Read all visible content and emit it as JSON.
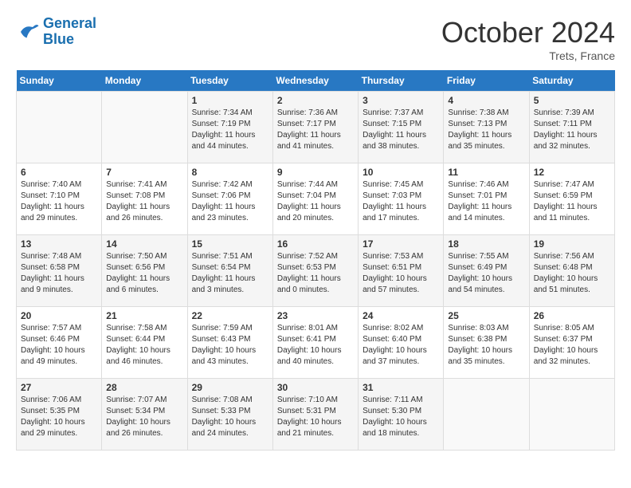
{
  "logo": {
    "line1": "General",
    "line2": "Blue"
  },
  "title": "October 2024",
  "subtitle": "Trets, France",
  "days_header": [
    "Sunday",
    "Monday",
    "Tuesday",
    "Wednesday",
    "Thursday",
    "Friday",
    "Saturday"
  ],
  "weeks": [
    [
      {
        "day": "",
        "sunrise": "",
        "sunset": "",
        "daylight": ""
      },
      {
        "day": "",
        "sunrise": "",
        "sunset": "",
        "daylight": ""
      },
      {
        "day": "1",
        "sunrise": "Sunrise: 7:34 AM",
        "sunset": "Sunset: 7:19 PM",
        "daylight": "Daylight: 11 hours and 44 minutes."
      },
      {
        "day": "2",
        "sunrise": "Sunrise: 7:36 AM",
        "sunset": "Sunset: 7:17 PM",
        "daylight": "Daylight: 11 hours and 41 minutes."
      },
      {
        "day": "3",
        "sunrise": "Sunrise: 7:37 AM",
        "sunset": "Sunset: 7:15 PM",
        "daylight": "Daylight: 11 hours and 38 minutes."
      },
      {
        "day": "4",
        "sunrise": "Sunrise: 7:38 AM",
        "sunset": "Sunset: 7:13 PM",
        "daylight": "Daylight: 11 hours and 35 minutes."
      },
      {
        "day": "5",
        "sunrise": "Sunrise: 7:39 AM",
        "sunset": "Sunset: 7:11 PM",
        "daylight": "Daylight: 11 hours and 32 minutes."
      }
    ],
    [
      {
        "day": "6",
        "sunrise": "Sunrise: 7:40 AM",
        "sunset": "Sunset: 7:10 PM",
        "daylight": "Daylight: 11 hours and 29 minutes."
      },
      {
        "day": "7",
        "sunrise": "Sunrise: 7:41 AM",
        "sunset": "Sunset: 7:08 PM",
        "daylight": "Daylight: 11 hours and 26 minutes."
      },
      {
        "day": "8",
        "sunrise": "Sunrise: 7:42 AM",
        "sunset": "Sunset: 7:06 PM",
        "daylight": "Daylight: 11 hours and 23 minutes."
      },
      {
        "day": "9",
        "sunrise": "Sunrise: 7:44 AM",
        "sunset": "Sunset: 7:04 PM",
        "daylight": "Daylight: 11 hours and 20 minutes."
      },
      {
        "day": "10",
        "sunrise": "Sunrise: 7:45 AM",
        "sunset": "Sunset: 7:03 PM",
        "daylight": "Daylight: 11 hours and 17 minutes."
      },
      {
        "day": "11",
        "sunrise": "Sunrise: 7:46 AM",
        "sunset": "Sunset: 7:01 PM",
        "daylight": "Daylight: 11 hours and 14 minutes."
      },
      {
        "day": "12",
        "sunrise": "Sunrise: 7:47 AM",
        "sunset": "Sunset: 6:59 PM",
        "daylight": "Daylight: 11 hours and 11 minutes."
      }
    ],
    [
      {
        "day": "13",
        "sunrise": "Sunrise: 7:48 AM",
        "sunset": "Sunset: 6:58 PM",
        "daylight": "Daylight: 11 hours and 9 minutes."
      },
      {
        "day": "14",
        "sunrise": "Sunrise: 7:50 AM",
        "sunset": "Sunset: 6:56 PM",
        "daylight": "Daylight: 11 hours and 6 minutes."
      },
      {
        "day": "15",
        "sunrise": "Sunrise: 7:51 AM",
        "sunset": "Sunset: 6:54 PM",
        "daylight": "Daylight: 11 hours and 3 minutes."
      },
      {
        "day": "16",
        "sunrise": "Sunrise: 7:52 AM",
        "sunset": "Sunset: 6:53 PM",
        "daylight": "Daylight: 11 hours and 0 minutes."
      },
      {
        "day": "17",
        "sunrise": "Sunrise: 7:53 AM",
        "sunset": "Sunset: 6:51 PM",
        "daylight": "Daylight: 10 hours and 57 minutes."
      },
      {
        "day": "18",
        "sunrise": "Sunrise: 7:55 AM",
        "sunset": "Sunset: 6:49 PM",
        "daylight": "Daylight: 10 hours and 54 minutes."
      },
      {
        "day": "19",
        "sunrise": "Sunrise: 7:56 AM",
        "sunset": "Sunset: 6:48 PM",
        "daylight": "Daylight: 10 hours and 51 minutes."
      }
    ],
    [
      {
        "day": "20",
        "sunrise": "Sunrise: 7:57 AM",
        "sunset": "Sunset: 6:46 PM",
        "daylight": "Daylight: 10 hours and 49 minutes."
      },
      {
        "day": "21",
        "sunrise": "Sunrise: 7:58 AM",
        "sunset": "Sunset: 6:44 PM",
        "daylight": "Daylight: 10 hours and 46 minutes."
      },
      {
        "day": "22",
        "sunrise": "Sunrise: 7:59 AM",
        "sunset": "Sunset: 6:43 PM",
        "daylight": "Daylight: 10 hours and 43 minutes."
      },
      {
        "day": "23",
        "sunrise": "Sunrise: 8:01 AM",
        "sunset": "Sunset: 6:41 PM",
        "daylight": "Daylight: 10 hours and 40 minutes."
      },
      {
        "day": "24",
        "sunrise": "Sunrise: 8:02 AM",
        "sunset": "Sunset: 6:40 PM",
        "daylight": "Daylight: 10 hours and 37 minutes."
      },
      {
        "day": "25",
        "sunrise": "Sunrise: 8:03 AM",
        "sunset": "Sunset: 6:38 PM",
        "daylight": "Daylight: 10 hours and 35 minutes."
      },
      {
        "day": "26",
        "sunrise": "Sunrise: 8:05 AM",
        "sunset": "Sunset: 6:37 PM",
        "daylight": "Daylight: 10 hours and 32 minutes."
      }
    ],
    [
      {
        "day": "27",
        "sunrise": "Sunrise: 7:06 AM",
        "sunset": "Sunset: 5:35 PM",
        "daylight": "Daylight: 10 hours and 29 minutes."
      },
      {
        "day": "28",
        "sunrise": "Sunrise: 7:07 AM",
        "sunset": "Sunset: 5:34 PM",
        "daylight": "Daylight: 10 hours and 26 minutes."
      },
      {
        "day": "29",
        "sunrise": "Sunrise: 7:08 AM",
        "sunset": "Sunset: 5:33 PM",
        "daylight": "Daylight: 10 hours and 24 minutes."
      },
      {
        "day": "30",
        "sunrise": "Sunrise: 7:10 AM",
        "sunset": "Sunset: 5:31 PM",
        "daylight": "Daylight: 10 hours and 21 minutes."
      },
      {
        "day": "31",
        "sunrise": "Sunrise: 7:11 AM",
        "sunset": "Sunset: 5:30 PM",
        "daylight": "Daylight: 10 hours and 18 minutes."
      },
      {
        "day": "",
        "sunrise": "",
        "sunset": "",
        "daylight": ""
      },
      {
        "day": "",
        "sunrise": "",
        "sunset": "",
        "daylight": ""
      }
    ]
  ]
}
